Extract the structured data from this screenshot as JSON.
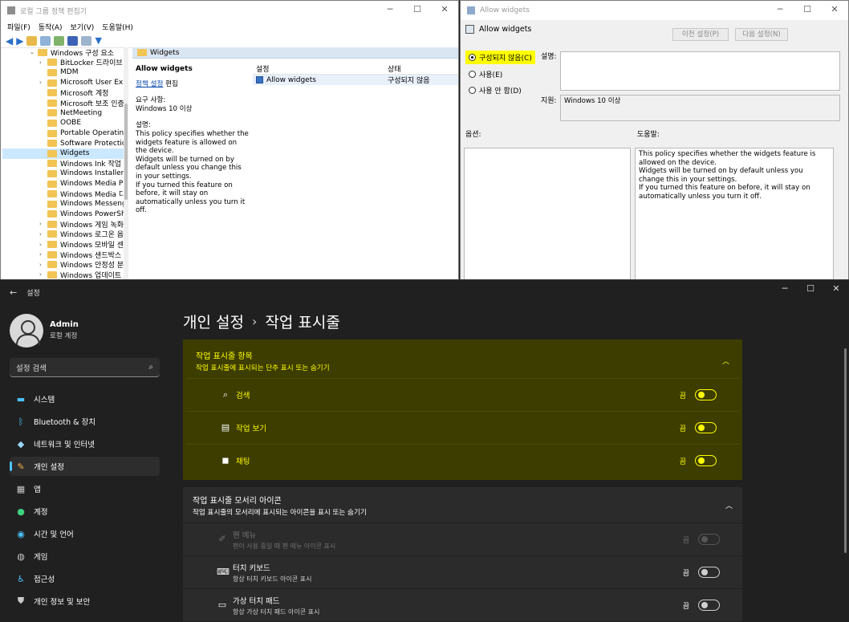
{
  "gpedit": {
    "title": "로컬 그룹 정책 편집기",
    "menu": [
      "파일(F)",
      "동작(A)",
      "보기(V)",
      "도움말(H)"
    ],
    "tree_root": "Windows 구성 요소",
    "tree": [
      "BitLocker 드라이브 암",
      "MDM",
      "Microsoft User Expe",
      "Microsoft 계정",
      "Microsoft 보조 인증",
      "NetMeeting",
      "OOBE",
      "Portable Operating S",
      "Software Protection",
      "Widgets",
      "Windows Ink 작업 영",
      "Windows Installer",
      "Windows Media Play",
      "Windows Media 디지",
      "Windows Messenger",
      "Windows PowerShe",
      "Windows 게임 녹화",
      "Windows 로그온 옵",
      "Windows 모바일 센",
      "Windows 샌드박스",
      "Windows 안정성 분",
      "Windows 업데이트"
    ],
    "breadcrumb": "Widgets",
    "desc": {
      "title": "Allow widgets",
      "edit_link": "정책 설정",
      "edit_suffix": " 편집",
      "req_label": "요구 사항:",
      "req_value": "Windows 10 이상",
      "desc_label": "설명:",
      "desc_text": "This policy specifies whether the widgets feature is allowed on the device.\nWidgets will be turned on by default unless you change this in your settings.\nIf you turned this feature on before, it will stay on automatically unless you turn it off."
    },
    "list": {
      "col_setting": "설정",
      "col_state": "상태",
      "rows": [
        {
          "name": "Allow widgets",
          "state": "구성되지 않음"
        }
      ]
    }
  },
  "dialog": {
    "title": "Allow widgets",
    "subtitle": "Allow widgets",
    "prev_button": "이전 설정(P)",
    "next_button": "다음 설정(N)",
    "radio_not_configured": "구성되지 않음(C)",
    "radio_enabled": "사용(E)",
    "radio_disabled": "사용 안 함(D)",
    "comment_label": "설명:",
    "support_label": "지원:",
    "support_value": "Windows 10 이상",
    "options_label": "옵션:",
    "help_label": "도움말:",
    "help_text": "This policy specifies whether the widgets feature is allowed on the device.\nWidgets will be turned on by default unless you change this in your settings.\nIf you turned this feature on before, it will stay on automatically unless you turn it off."
  },
  "settings": {
    "title": "설정",
    "user_name": "Admin",
    "user_sub": "로컬 계정",
    "search_placeholder": "설정 검색",
    "nav": [
      {
        "label": "시스템",
        "icon": "monitor-icon",
        "color": "#4cc2ff"
      },
      {
        "label": "Bluetooth & 장치",
        "icon": "bluetooth-icon",
        "color": "#4cc2ff"
      },
      {
        "label": "네트워크 및 인터넷",
        "icon": "wifi-icon",
        "color": "#9ad8ff"
      },
      {
        "label": "개인 설정",
        "icon": "brush-icon",
        "color": "#f5b04b"
      },
      {
        "label": "앱",
        "icon": "apps-icon",
        "color": "#c9c9c9"
      },
      {
        "label": "계정",
        "icon": "person-icon",
        "color": "#3ed17e"
      },
      {
        "label": "시간 및 언어",
        "icon": "globe-icon",
        "color": "#4cc2ff"
      },
      {
        "label": "게임",
        "icon": "gamepad-icon",
        "color": "#c9c9c9"
      },
      {
        "label": "접근성",
        "icon": "accessibility-icon",
        "color": "#4cc2ff"
      },
      {
        "label": "개인 정보 및 보안",
        "icon": "shield-icon",
        "color": "#c9c9c9"
      }
    ],
    "breadcrumb_parent": "개인 설정",
    "breadcrumb_sep": "›",
    "breadcrumb_current": "작업 표시줄",
    "section1": {
      "title": "작업 표시줄 항목",
      "subtitle": "작업 표시줄에 표시되는 단추 표시 또는 숨기기",
      "items": [
        {
          "label": "검색",
          "state": "끔",
          "icon": "search-icon"
        },
        {
          "label": "작업 보기",
          "state": "끔",
          "icon": "task-view-icon"
        },
        {
          "label": "채팅",
          "state": "끔",
          "icon": "chat-icon"
        }
      ]
    },
    "section2": {
      "title": "작업 표시줄 모서리 아이콘",
      "subtitle": "작업 표시줄의 모서리에 표시되는 아이콘을 표시 또는 숨기기",
      "items": [
        {
          "label": "펜 메뉴",
          "sub": "펜이 사용 중일 때 펜 메뉴 아이콘 표시",
          "state": "끔",
          "icon": "pen-icon",
          "disabled": true
        },
        {
          "label": "터치 키보드",
          "sub": "항상 터치 키보드 아이콘 표시",
          "state": "끔",
          "icon": "keyboard-icon"
        },
        {
          "label": "가상 터치 패드",
          "sub": "항상 가상 터치 패드 아이콘 표시",
          "state": "끔",
          "icon": "touchpad-icon"
        }
      ]
    },
    "colors": {
      "highlight_bg": "#3d3d00",
      "highlight_text": "#ffff00",
      "accent": "#4cc2ff"
    }
  }
}
